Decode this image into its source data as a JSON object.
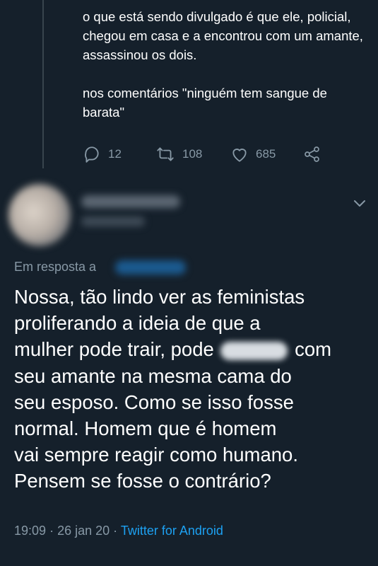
{
  "quoted_tweet": {
    "paragraphs": [
      "o que está sendo divulgado é que ele, policial, chegou em casa e a encontrou com um amante, assassinou os dois.",
      "nos comentários \"ninguém tem sangue de barata\""
    ],
    "replies": "12",
    "retweets": "108",
    "likes": "685",
    "icons": [
      "reply-icon",
      "retweet-icon",
      "like-icon",
      "share-icon"
    ]
  },
  "tweet": {
    "in_reply_to": "Em resposta a",
    "lines": {
      "l1": "Nossa, tão lindo ver as feministas",
      "l2": "proliferando a ideia de que a",
      "l3a": "mulher pode trair, pode",
      "l3b": "com",
      "l4": "seu amante na mesma cama do",
      "l5": "seu esposo. Como se isso fosse",
      "l6": "normal. Homem que é homem",
      "l7": "vai sempre reagir como humano.",
      "l8": "Pensem se fosse o contrário?"
    },
    "time": "19:09",
    "separator": "·",
    "date": "26 jan 20",
    "source": "Twitter for Android"
  },
  "colors": {
    "background": "#15202b",
    "secondary_text": "#8899a6",
    "link": "#1da1f2",
    "thread_line": "#38444d"
  }
}
